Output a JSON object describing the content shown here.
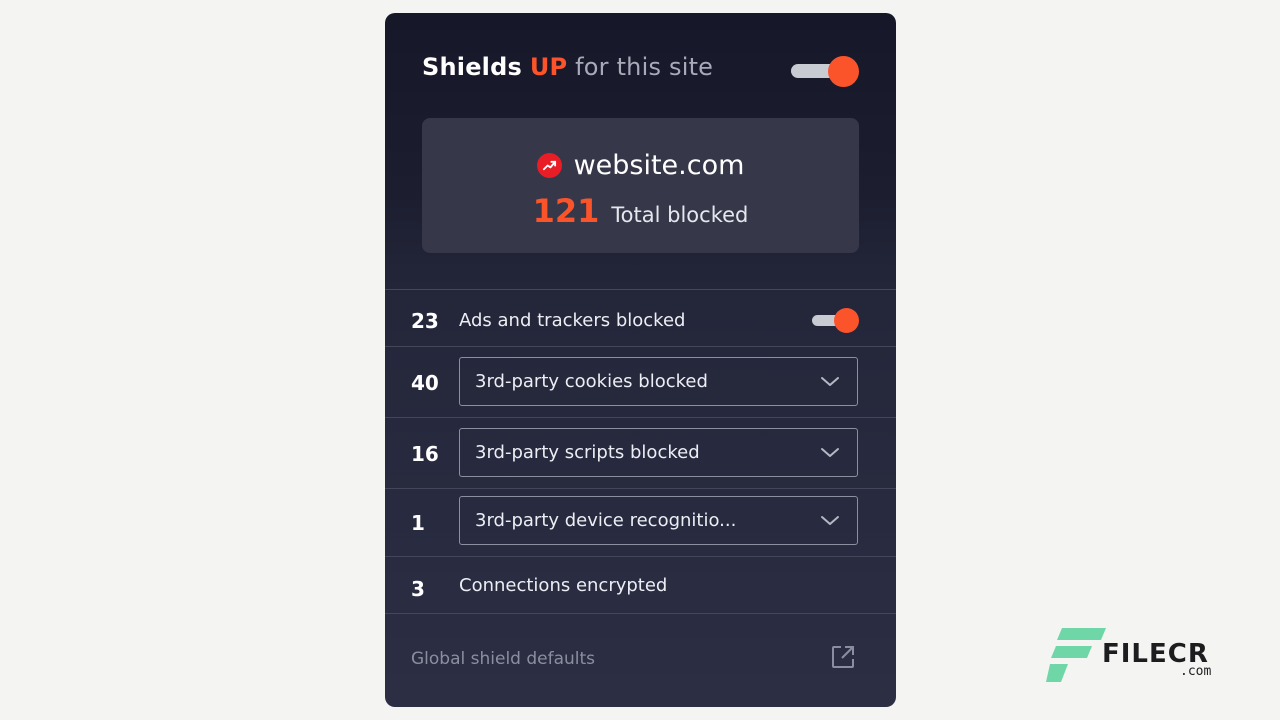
{
  "header": {
    "title_bold": "Shields",
    "title_up": "UP",
    "title_rest": "for this site",
    "shields_enabled": true
  },
  "site": {
    "domain": "website.com",
    "favicon_icon": "trending-up-icon",
    "total_blocked_count": "121",
    "total_blocked_label": "Total blocked"
  },
  "rows": [
    {
      "count": "23",
      "label": "Ads and trackers blocked",
      "control": "toggle",
      "enabled": true
    },
    {
      "count": "40",
      "label": "3rd-party cookies blocked",
      "control": "select"
    },
    {
      "count": "16",
      "label": "3rd-party scripts blocked",
      "control": "select"
    },
    {
      "count": "1",
      "label": "3rd-party device recognitio...",
      "control": "select"
    },
    {
      "count": "3",
      "label": "Connections encrypted",
      "control": "none"
    }
  ],
  "footer": {
    "label": "Global shield defaults",
    "icon": "external-link-icon"
  },
  "watermark": {
    "brand": "FILECR",
    "suffix": ".com"
  },
  "colors": {
    "accent": "#fb542b",
    "panel_bg": "#1c1e30",
    "card_bg": "#363849",
    "favicon_red": "#e81d25",
    "watermark_green": "#6fd6a8"
  }
}
